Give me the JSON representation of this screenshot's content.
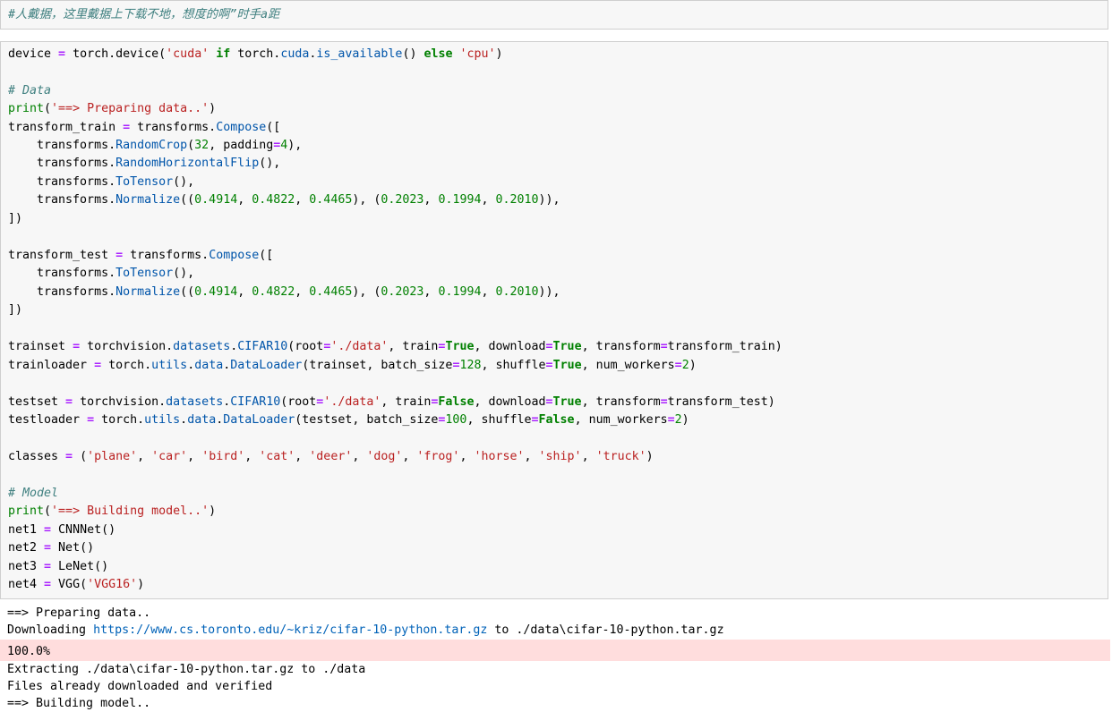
{
  "comment_cell": {
    "text": "#人戴据，这里戴据上下载不地，想度的啊”时手a距"
  },
  "code": {
    "l01": {
      "a": "device ",
      "b": "=",
      "c": " torch",
      "d": ".",
      "e": "device(",
      "f": "'cuda'",
      "g": " ",
      "h": "if",
      "i": " torch",
      "j": ".",
      "k": "cuda",
      "l": ".",
      "m": "is_available",
      "n": "() ",
      "o": "else",
      "p": " ",
      "q": "'cpu'",
      "r": ")"
    },
    "l02": {
      "c": "# Data"
    },
    "l03": {
      "a": "print",
      "b": "(",
      "c": "'==> Preparing data..'",
      "d": ")"
    },
    "l04": {
      "a": "transform_train ",
      "b": "=",
      "c": " transforms",
      "d": ".",
      "e": "Compose",
      "f": "(["
    },
    "l05": {
      "a": "    transforms",
      "b": ".",
      "c": "RandomCrop",
      "d": "(",
      "e": "32",
      "f": ", padding",
      "g": "=",
      "h": "4",
      "i": "),"
    },
    "l06": {
      "a": "    transforms",
      "b": ".",
      "c": "RandomHorizontalFlip",
      "d": "(),"
    },
    "l07": {
      "a": "    transforms",
      "b": ".",
      "c": "ToTensor",
      "d": "(),"
    },
    "l08": {
      "a": "    transforms",
      "b": ".",
      "c": "Normalize",
      "d": "((",
      "e": "0.4914",
      "f": ", ",
      "g": "0.4822",
      "h": ", ",
      "i": "0.4465",
      "j": "), (",
      "k": "0.2023",
      "l": ", ",
      "m": "0.1994",
      "n": ", ",
      "o": "0.2010",
      "p": ")),"
    },
    "l09": {
      "a": "])"
    },
    "l10": {
      "a": "transform_test ",
      "b": "=",
      "c": " transforms",
      "d": ".",
      "e": "Compose",
      "f": "(["
    },
    "l11": {
      "a": "    transforms",
      "b": ".",
      "c": "ToTensor",
      "d": "(),"
    },
    "l12": {
      "a": "    transforms",
      "b": ".",
      "c": "Normalize",
      "d": "((",
      "e": "0.4914",
      "f": ", ",
      "g": "0.4822",
      "h": ", ",
      "i": "0.4465",
      "j": "), (",
      "k": "0.2023",
      "l": ", ",
      "m": "0.1994",
      "n": ", ",
      "o": "0.2010",
      "p": ")),"
    },
    "l13": {
      "a": "])"
    },
    "l14": {
      "a": "trainset ",
      "b": "=",
      "c": " torchvision",
      "d": ".",
      "e": "datasets",
      "f": ".",
      "g": "CIFAR10",
      "h": "(root",
      "i": "=",
      "j": "'./data'",
      "k": ", train",
      "l": "=",
      "m": "True",
      "n": ", download",
      "o": "=",
      "p": "True",
      "q": ", transform",
      "r": "=",
      "s": "transform_train)"
    },
    "l15": {
      "a": "trainloader ",
      "b": "=",
      "c": " torch",
      "d": ".",
      "e": "utils",
      "f": ".",
      "g": "data",
      "h": ".",
      "i": "DataLoader",
      "j": "(trainset, batch_size",
      "k": "=",
      "l": "128",
      "m": ", shuffle",
      "n": "=",
      "o": "True",
      "p": ", num_workers",
      "q": "=",
      "r": "2",
      "s": ")"
    },
    "l16": {
      "a": "testset ",
      "b": "=",
      "c": " torchvision",
      "d": ".",
      "e": "datasets",
      "f": ".",
      "g": "CIFAR10",
      "h": "(root",
      "i": "=",
      "j": "'./data'",
      "k": ", train",
      "l": "=",
      "m": "False",
      "n": ", download",
      "o": "=",
      "p": "True",
      "q": ", transform",
      "r": "=",
      "s": "transform_test)"
    },
    "l17": {
      "a": "testloader ",
      "b": "=",
      "c": " torch",
      "d": ".",
      "e": "utils",
      "f": ".",
      "g": "data",
      "h": ".",
      "i": "DataLoader",
      "j": "(testset, batch_size",
      "k": "=",
      "l": "100",
      "m": ", shuffle",
      "n": "=",
      "o": "False",
      "p": ", num_workers",
      "q": "=",
      "r": "2",
      "s": ")"
    },
    "l18": {
      "a": "classes ",
      "b": "=",
      "c": " (",
      "d": "'plane'",
      "e": ", ",
      "f": "'car'",
      "g": ", ",
      "h": "'bird'",
      "i": ", ",
      "j": "'cat'",
      "k": ", ",
      "l": "'deer'",
      "m": ", ",
      "n": "'dog'",
      "o": ", ",
      "p": "'frog'",
      "q": ", ",
      "r": "'horse'",
      "s": ", ",
      "t": "'ship'",
      "u": ", ",
      "v": "'truck'",
      "w": ")"
    },
    "l19": {
      "c": "# Model"
    },
    "l20": {
      "a": "print",
      "b": "(",
      "c": "'==> Building model..'",
      "d": ")"
    },
    "l21": {
      "a": "net1 ",
      "b": "=",
      "c": " CNNNet()"
    },
    "l22": {
      "a": "net2 ",
      "b": "=",
      "c": " Net()"
    },
    "l23": {
      "a": "net3 ",
      "b": "=",
      "c": " LeNet()"
    },
    "l24": {
      "a": "net4 ",
      "b": "=",
      "c": " VGG(",
      "d": "'VGG16'",
      "e": ")"
    }
  },
  "output": {
    "line1": "==> Preparing data..",
    "line2_prefix": "Downloading ",
    "line2_url": "https://www.cs.toronto.edu/~kriz/cifar-10-python.tar.gz",
    "line2_suffix": " to ./data\\cifar-10-python.tar.gz",
    "progress": "100.0%",
    "line4": "Extracting ./data\\cifar-10-python.tar.gz to ./data",
    "line5": "Files already downloaded and verified",
    "line6": "==> Building model.."
  },
  "colors": {
    "cell_bg": "#f7f7f7",
    "cell_border": "#cfcfcf",
    "stderr_bg": "#ffdddd",
    "keyword": "#008000",
    "string": "#ba2121",
    "operator": "#aa22ff",
    "comment": "#408080"
  }
}
